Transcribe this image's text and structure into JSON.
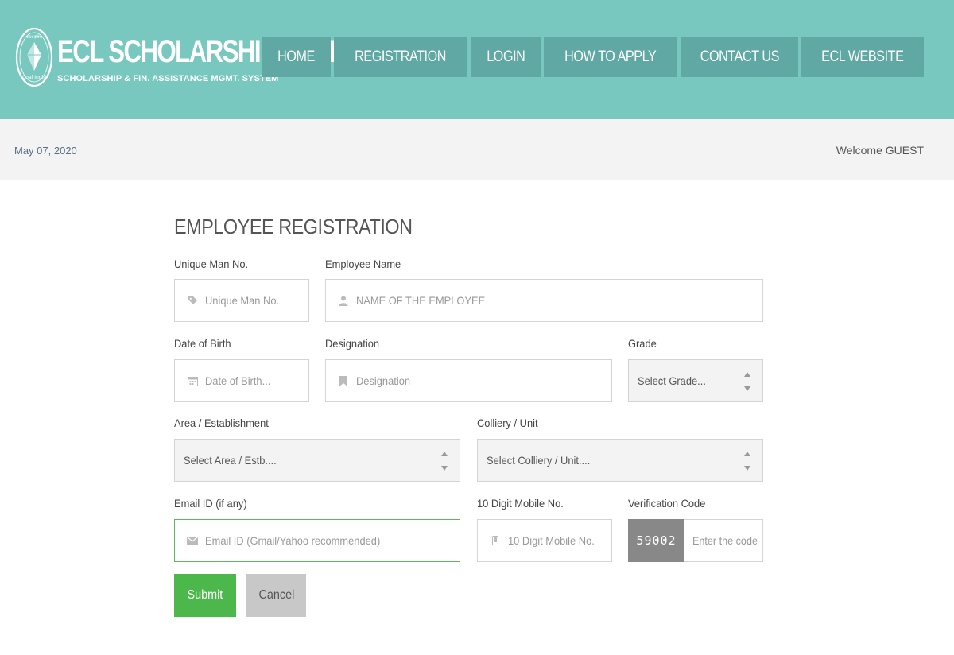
{
  "header": {
    "emblem_text_top": "कोल इंडिया",
    "emblem_text_bottom": "Coal India",
    "title": "ECL SCHOLARSHIP SCHEME",
    "subtitle": "SCHOLARSHIP & FIN. ASSISTANCE MGMT. SYSTEM",
    "bg_color": "#78c8bf",
    "nav": [
      {
        "label": "HOME"
      },
      {
        "label": "REGISTRATION"
      },
      {
        "label": "LOGIN"
      },
      {
        "label": "HOW TO APPLY"
      },
      {
        "label": "CONTACT US"
      },
      {
        "label": "ECL WEBSITE"
      }
    ]
  },
  "subbar": {
    "date": "May 07, 2020",
    "welcome": "Welcome GUEST"
  },
  "form": {
    "title": "EMPLOYEE REGISTRATION",
    "unique_man_no": {
      "label": "Unique Man No.",
      "placeholder": "Unique Man No.",
      "icon": "tag-icon"
    },
    "employee_name": {
      "label": "Employee Name",
      "placeholder": "NAME OF THE EMPLOYEE",
      "icon": "user-icon"
    },
    "dob": {
      "label": "Date of Birth",
      "placeholder": "Date of Birth...",
      "icon": "calendar-icon"
    },
    "designation": {
      "label": "Designation",
      "placeholder": "Designation",
      "icon": "bookmark-icon"
    },
    "grade": {
      "label": "Grade",
      "value": "Select Grade..."
    },
    "area": {
      "label": "Area / Establishment",
      "value": "Select Area / Estb...."
    },
    "colliery": {
      "label": "Colliery / Unit",
      "value": "Select Colliery / Unit...."
    },
    "email": {
      "label": "Email ID (if any)",
      "placeholder": "Email ID (Gmail/Yahoo recommended)",
      "icon": "envelope-icon"
    },
    "mobile": {
      "label": "10 Digit Mobile No.",
      "placeholder": "10 Digit Mobile No.",
      "icon": "mobile-icon"
    },
    "verification": {
      "label": "Verification Code",
      "captcha": "59002",
      "placeholder": "Enter the code"
    },
    "submit_label": "Submit",
    "cancel_label": "Cancel",
    "submit_color": "#4cb84c",
    "cancel_color": "#c8c8c8"
  }
}
